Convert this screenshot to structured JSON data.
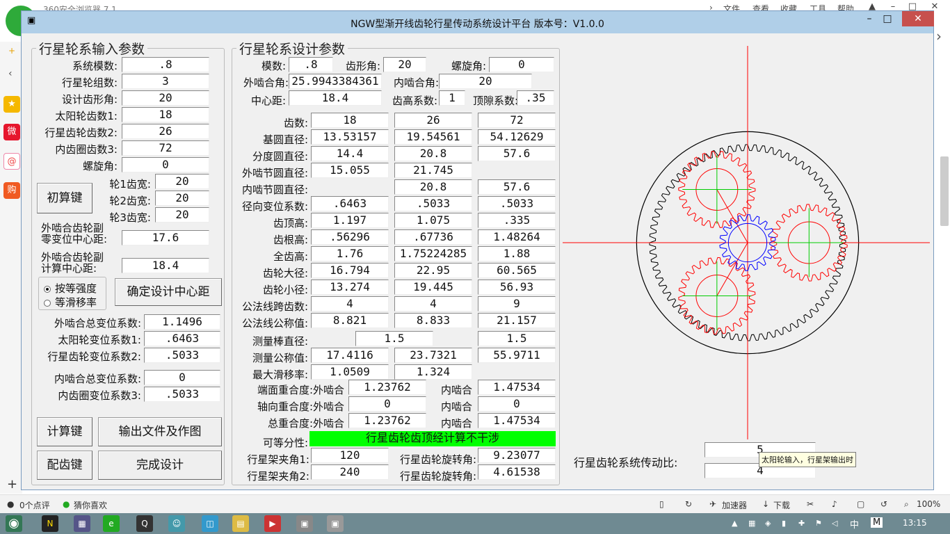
{
  "browser": {
    "title": "360安全浏览器 7.1",
    "menu": [
      "文件",
      "查看",
      "收藏",
      "工具",
      "帮助"
    ],
    "statusbar": {
      "comments": "0个点评",
      "like": "猜你喜欢",
      "accelerator": "加速器",
      "download": "下载",
      "zoom": "100%"
    }
  },
  "taskbar": {
    "time": "13:15",
    "ime": "中",
    "ime2": "M"
  },
  "window": {
    "title": "NGW型渐开线齿轮行星传动系统设计平台  版本号：V1.0.0",
    "controls": {
      "min": "–",
      "max": "□",
      "close": "✕"
    },
    "cb_icon": "▣"
  },
  "input": {
    "legend": "行星轮系输入参数",
    "rows": [
      {
        "label": "系统模数:",
        "value": ".8"
      },
      {
        "label": "行星轮组数:",
        "value": "3"
      },
      {
        "label": "设计齿形角:",
        "value": "20"
      },
      {
        "label": "太阳轮齿数1:",
        "value": "18"
      },
      {
        "label": "行星齿轮齿数2:",
        "value": "26"
      },
      {
        "label": "内齿圈齿数3:",
        "value": "72"
      },
      {
        "label": "螺旋角:",
        "value": "0"
      }
    ],
    "width_rows": [
      {
        "label": "轮1齿宽:",
        "value": "20"
      },
      {
        "label": "轮2齿宽:",
        "value": "20"
      },
      {
        "label": "轮3齿宽:",
        "value": "20"
      }
    ],
    "calc_button": "初算键",
    "zero_center_label1": "外啮合齿轮副",
    "zero_center_label2": "零变位中心距:",
    "zero_center_value": "17.6",
    "calc_center_label1": "外啮合齿轮副",
    "calc_center_label2": "计算中心距:",
    "calc_center_value": "18.4",
    "radio1": "按等强度",
    "radio2": "等滑移率",
    "confirm_button": "确定设计中心距",
    "shift_rows": [
      {
        "label": "外啮合总变位系数:",
        "value": "1.1496"
      },
      {
        "label": "太阳轮变位系数1:",
        "value": ".6463"
      },
      {
        "label": "行星齿轮变位系数2:",
        "value": ".5033"
      }
    ],
    "shift_rows2": [
      {
        "label": "内啮合总变位系数:",
        "value": "0"
      },
      {
        "label": "内齿圈变位系数3:",
        "value": ".5033"
      }
    ],
    "compute_button": "计算键",
    "output_button": "输出文件及作图",
    "match_button": "配齿键",
    "finish_button": "完成设计"
  },
  "design": {
    "legend": "行星轮系设计参数",
    "module_label": "模数:",
    "module": ".8",
    "pressure_label": "齿形角:",
    "pressure": "20",
    "helix_label": "螺旋角:",
    "helix": "0",
    "ext_angle_label": "外啮合角:",
    "ext_angle": "25.9943384361",
    "int_angle_label": "内啮合角:",
    "int_angle": "20",
    "center_label": "中心距:",
    "center": "18.4",
    "addendum_label": "齿高系数:",
    "addendum": "1",
    "clearance_label": "顶隙系数:",
    "clearance": ".35",
    "table": [
      {
        "label": "齿数:",
        "v": [
          "18",
          "26",
          "72"
        ]
      },
      {
        "label": "基圆直径:",
        "v": [
          "13.53157",
          "19.54561",
          "54.12629"
        ]
      },
      {
        "label": "分度圆直径:",
        "v": [
          "14.4",
          "20.8",
          "57.6"
        ]
      },
      {
        "label": "外啮节圆直径:",
        "v": [
          "15.055",
          "21.745",
          ""
        ]
      },
      {
        "label": "内啮节圆直径:",
        "v": [
          "",
          "20.8",
          "57.6"
        ]
      },
      {
        "label": "径向变位系数:",
        "v": [
          ".6463",
          ".5033",
          ".5033"
        ]
      },
      {
        "label": "齿顶高:",
        "v": [
          "1.197",
          "1.075",
          ".335"
        ]
      },
      {
        "label": "齿根高:",
        "v": [
          ".56296",
          ".67736",
          "1.48264"
        ]
      },
      {
        "label": "全齿高:",
        "v": [
          "1.76",
          "1.75224285",
          "1.88"
        ]
      },
      {
        "label": "齿轮大径:",
        "v": [
          "16.794",
          "22.95",
          "60.565"
        ]
      },
      {
        "label": "齿轮小径:",
        "v": [
          "13.274",
          "19.445",
          "56.93"
        ]
      },
      {
        "label": "公法线跨齿数:",
        "v": [
          "4",
          "4",
          "9"
        ]
      },
      {
        "label": "公法线公称值:",
        "v": [
          "8.821",
          "8.833",
          "21.157"
        ]
      }
    ],
    "rod_label": "测量棒直径:",
    "rod_ext": "1.5",
    "rod_int": "1.5",
    "measure_label": "测量公称值:",
    "measure": [
      "17.4116",
      "23.7321",
      "55.9711"
    ],
    "slip_label": "最大滑移率:",
    "slip": [
      "1.0509",
      "1.324"
    ],
    "contact_rows": [
      {
        "label": "端面重合度:外啮合",
        "ext": "1.23762",
        "int_label": "内啮合",
        "int": "1.47534"
      },
      {
        "label": "轴向重合度:外啮合",
        "ext": "0",
        "int_label": "内啮合",
        "int": "0"
      },
      {
        "label": "总重合度:外啮合",
        "ext": "1.23762",
        "int_label": "内啮合",
        "int": "1.47534"
      }
    ],
    "assembly_label": "可等分性:",
    "assembly_msg": "行星齿轮齿顶经计算不干涉",
    "carrier1_label": "行星架夹角1:",
    "carrier1": "120",
    "rot1_label": "行星齿轮旋转角:",
    "rot1": "9.23077",
    "carrier2_label": "行星架夹角2:",
    "carrier2": "240",
    "rot2_label": "行星齿轮旋转角:",
    "rot2": "4.61538"
  },
  "ratio": {
    "label": "行星齿轮系统传动比:",
    "value1": "5",
    "value2": "4",
    "tooltip": "太阳轮输入，行星架输出时"
  },
  "colors": {
    "ring": "#000000",
    "sun": "#0000ff",
    "planet": "#ff0000",
    "axis": "#ff0000",
    "planet_axis": "#00cc00",
    "ok": "#00ff00"
  }
}
